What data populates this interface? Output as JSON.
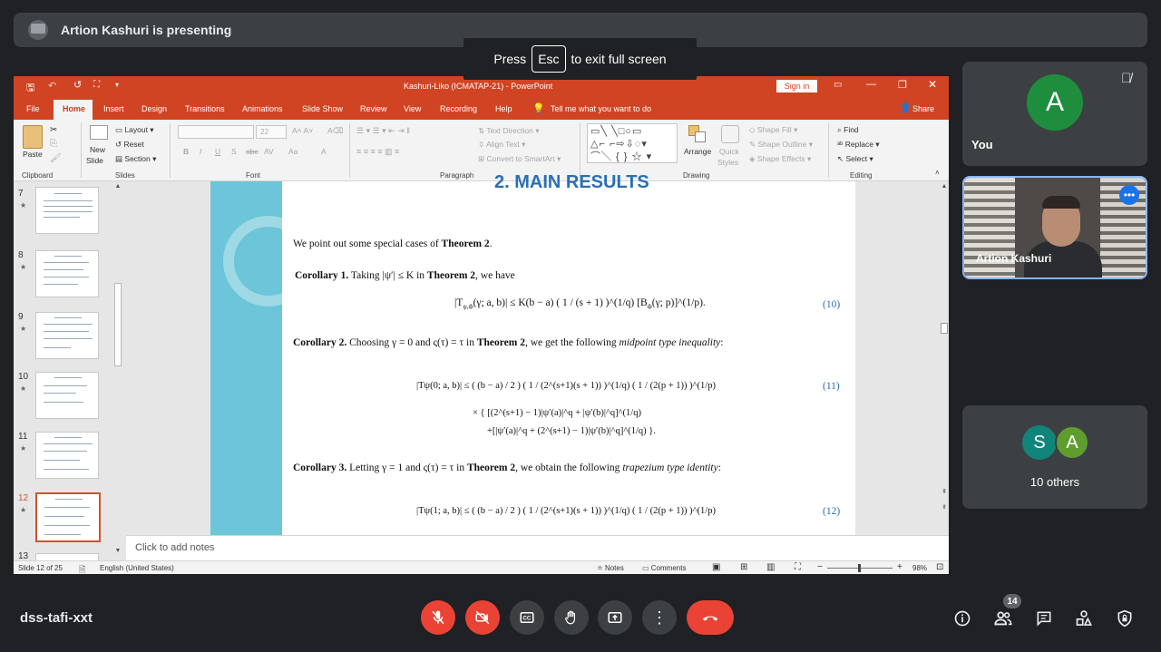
{
  "meet": {
    "presenter_banner": "Artion Kashuri is presenting",
    "esc_prefix": "Press",
    "esc_key": "Esc",
    "esc_suffix": "to exit full screen",
    "meeting_code": "dss-tafi-xxt",
    "participants_count": "14",
    "tiles": {
      "you_label": "You",
      "you_initial": "A",
      "presenter_label": "Artion Kashuri",
      "others_label": "10 others",
      "others_initials": [
        "S",
        "A"
      ]
    },
    "colors": {
      "you_avatar": "#1e8e3e",
      "s_avatar": "#12857b",
      "a_avatar": "#5f9e2e",
      "end_call": "#ea4335",
      "accent": "#8ab4f8"
    }
  },
  "ppt": {
    "window_title": "Kashuri-Liko (ICMATAP-21) - PowerPoint",
    "sign_in": "Sign in",
    "tabs": [
      "File",
      "Home",
      "Insert",
      "Design",
      "Transitions",
      "Animations",
      "Slide Show",
      "Review",
      "View",
      "Recording",
      "Help"
    ],
    "tell_me": "Tell me what you want to do",
    "share": "Share",
    "ribbon": {
      "paste": "Paste",
      "clipboard": "Clipboard",
      "new_slide_1": "New",
      "new_slide_2": "Slide",
      "layout": "Layout",
      "reset": "Reset",
      "section": "Section",
      "slides": "Slides",
      "font_size": "22",
      "font": "Font",
      "paragraph": "Paragraph",
      "text_direction": "Text Direction",
      "align_text": "Align Text",
      "convert_smartart": "Convert to SmartArt",
      "arrange": "Arrange",
      "quick_styles_1": "Quick",
      "quick_styles_2": "Styles",
      "shape_fill": "Shape Fill",
      "shape_outline": "Shape Outline",
      "shape_effects": "Shape Effects",
      "drawing": "Drawing",
      "find": "Find",
      "replace": "Replace",
      "select": "Select",
      "editing": "Editing"
    },
    "thumbnails": [
      {
        "num": "7",
        "star": "★"
      },
      {
        "num": "8",
        "star": "★"
      },
      {
        "num": "9",
        "star": "★"
      },
      {
        "num": "10",
        "star": "★"
      },
      {
        "num": "11",
        "star": "★"
      },
      {
        "num": "12",
        "star": "★"
      },
      {
        "num": "13",
        "star": ""
      }
    ],
    "notes_placeholder": "Click to add notes",
    "status": {
      "slide_of": "Slide 12 of 25",
      "language": "English (United States)",
      "notes": "Notes",
      "comments": "Comments",
      "zoom": "98%"
    }
  },
  "slide": {
    "heading": "2. MAIN RESULTS",
    "intro_a": "We point out some special cases of ",
    "intro_b": "Theorem 2",
    "intro_c": ".",
    "c1_label": "Corollary 1.",
    "c1_text_a": " Taking |ψ′| ≤ K in ",
    "c1_text_b": "Theorem 2",
    "c1_text_c": ", we have",
    "eq10": "|T",
    "eq10_tail": "(γ; a, b)| ≤ K(b − a) ( 1 / (s + 1) )^(1/q) [B",
    "eq10_end": "(γ; p)]^(1/p).",
    "eq10_num": "(10)",
    "c2_label": "Corollary 2.",
    "c2_text_a": " Choosing γ = 0 and ς(τ) = τ in ",
    "c2_text_b": "Theorem 2",
    "c2_text_c": ", we get the following ",
    "c2_text_d": "midpoint type inequality",
    "c2_text_e": ":",
    "eq11_line1": "|Tψ(0; a, b)| ≤ ( (b − a) / 2 ) ( 1 / (2^(s+1)(s + 1)) )^(1/q) ( 1 / (2(p + 1)) )^(1/p)",
    "eq11_line2": "× { [(2^(s+1) − 1)|ψ′(a)|^q + |ψ′(b)|^q]^(1/q)",
    "eq11_line3": "+[|ψ′(a)|^q + (2^(s+1) − 1)|ψ′(b)|^q]^(1/q) }.",
    "eq11_num": "(11)",
    "c3_label": "Corollary 3.",
    "c3_text_a": " Letting γ = 1 and ς(τ) = τ in ",
    "c3_text_b": "Theorem 2",
    "c3_text_c": ", we obtain the following ",
    "c3_text_d": "trapezium type identity",
    "c3_text_e": ":",
    "eq12_line1": "|Tψ(1; a, b)| ≤ ( (b − a) / 2 ) ( 1 / (2^(s+1)(s + 1)) )^(1/q) ( 1 / (2(p + 1)) )^(1/p)",
    "eq12_num": "(12)",
    "colors": {
      "heading": "#2a6fb5",
      "band": "#6cc5d8"
    }
  }
}
